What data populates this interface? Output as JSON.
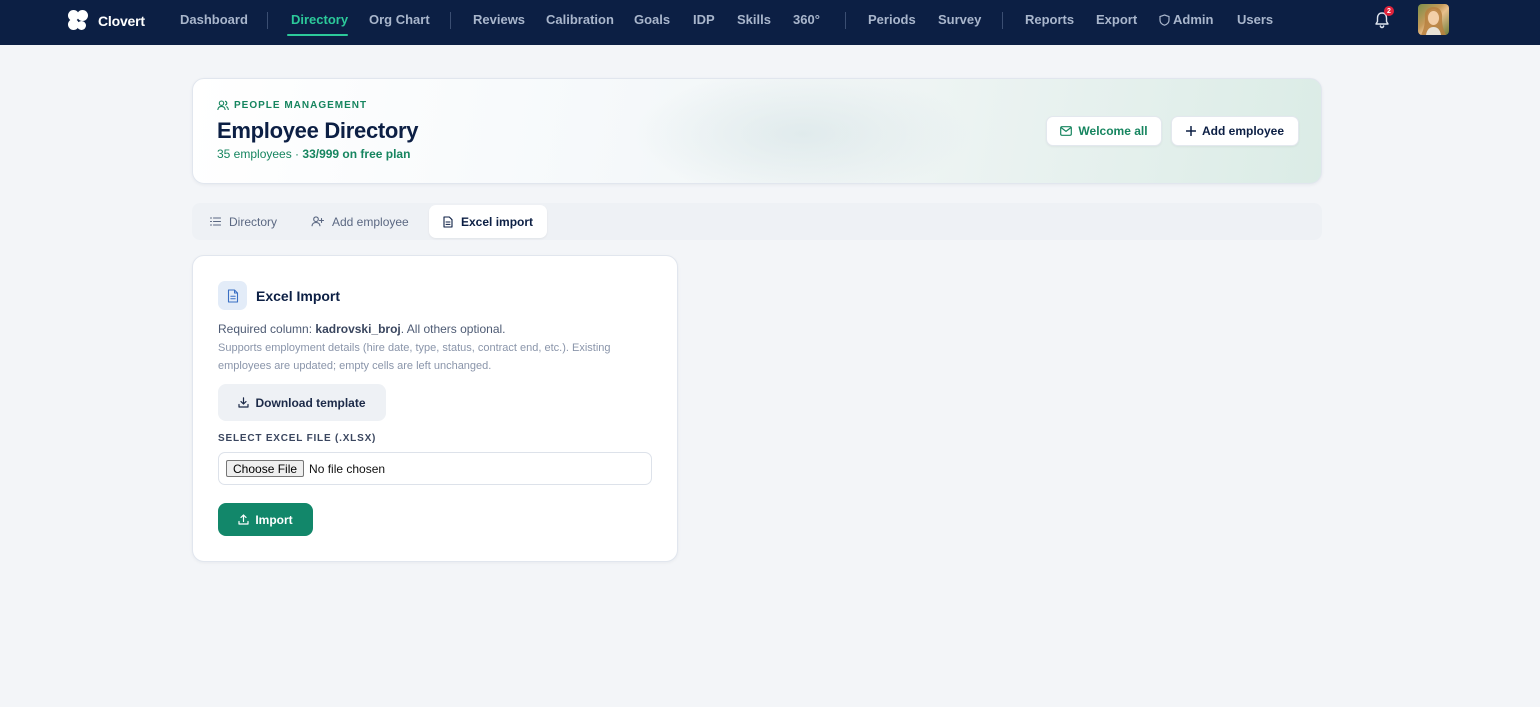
{
  "app": {
    "name": "Clovert"
  },
  "nav": {
    "items": [
      {
        "label": "Dashboard"
      },
      {
        "label": "Directory"
      },
      {
        "label": "Org Chart"
      },
      {
        "label": "Reviews"
      },
      {
        "label": "Calibration"
      },
      {
        "label": "Goals"
      },
      {
        "label": "IDP"
      },
      {
        "label": "Skills"
      },
      {
        "label": "360°"
      },
      {
        "label": "Periods"
      },
      {
        "label": "Survey"
      },
      {
        "label": "Reports"
      },
      {
        "label": "Export"
      },
      {
        "label": "Admin"
      },
      {
        "label": "Users"
      }
    ],
    "active": "Directory",
    "notification_count": "2"
  },
  "header": {
    "eyebrow": "PEOPLE MANAGEMENT",
    "title": "Employee Directory",
    "employee_count": "35 employees",
    "separator": " · ",
    "plan_usage": "33/999 on free plan",
    "welcome_label": "Welcome all",
    "add_label": "Add employee"
  },
  "tabs": [
    {
      "label": "Directory",
      "icon": "list-icon"
    },
    {
      "label": "Add employee",
      "icon": "user-plus-icon"
    },
    {
      "label": "Excel import",
      "icon": "file-icon"
    }
  ],
  "active_tab": "Excel import",
  "import": {
    "title": "Excel Import",
    "required_prefix": "Required column: ",
    "required_column": "kadrovski_broj",
    "required_suffix": ". All others optional.",
    "description": "Supports employment details (hire date, type, status, contract end, etc.). Existing employees are updated; empty cells are left unchanged.",
    "download_label": "Download template",
    "file_label": "SELECT EXCEL FILE (.XLSX)",
    "choose_file_label": "Choose File",
    "no_file_text": "No file chosen",
    "import_label": "Import"
  },
  "colors": {
    "nav_bg": "#0c1f44",
    "accent": "#2cc99a",
    "primary_green": "#12876a",
    "badge_red": "#e0233b"
  }
}
